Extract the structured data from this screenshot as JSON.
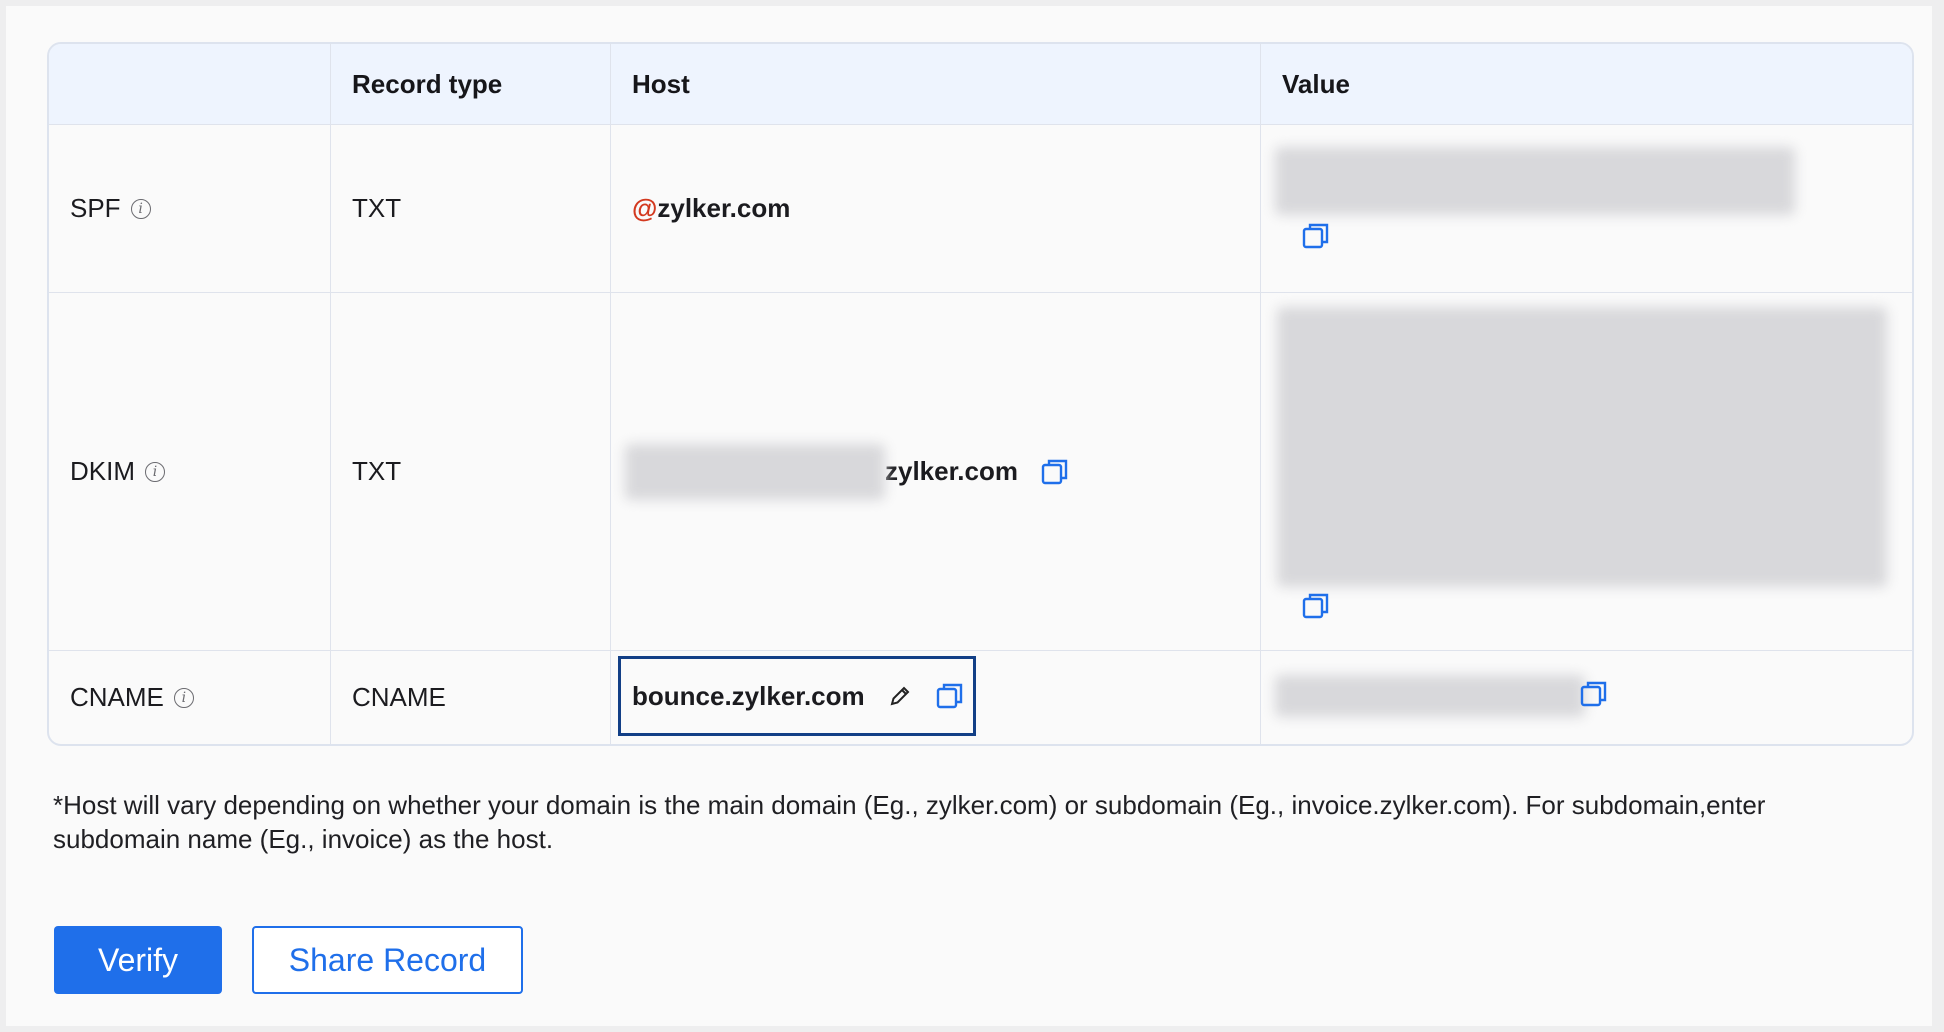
{
  "table": {
    "headers": [
      "",
      "Record type",
      "Host",
      "Value"
    ],
    "rows": [
      {
        "name": "SPF",
        "type": "TXT",
        "host_prefix": "@",
        "host": "zylker.com"
      },
      {
        "name": "DKIM",
        "type": "TXT",
        "host": "zylker.com"
      },
      {
        "name": "CNAME",
        "type": "CNAME",
        "host": "bounce.zylker.com"
      }
    ]
  },
  "note": "*Host will vary depending on whether your domain is the main domain (Eg., zylker.com) or subdomain (Eg., invoice.zylker.com). For subdomain,enter subdomain name (Eg., invoice) as the host.",
  "buttons": {
    "verify": "Verify",
    "share": "Share Record"
  },
  "icons": {
    "info": "info-icon",
    "copy": "copy-icon",
    "edit": "pencil-icon"
  },
  "colors": {
    "accent": "#1f6fea",
    "header_bg": "#eef4fe",
    "highlight_border": "#123f86",
    "at_sign": "#d3391f"
  }
}
